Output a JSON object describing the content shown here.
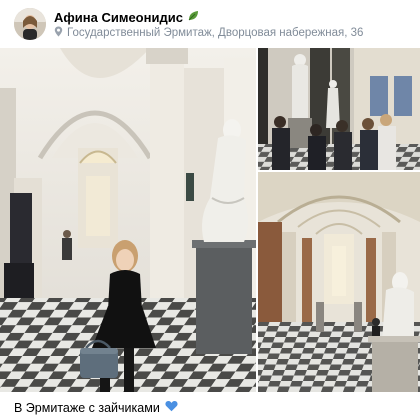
{
  "post": {
    "author": "Афина Симеонидис",
    "author_badge_icon": "leaf-emoji-icon",
    "location": "Государственный Эрмитаж, Дворцовая набережная, 36",
    "location_icon": "map-pin-icon",
    "caption": "В Эрмитаже с зайчиками",
    "caption_emoji_icon": "blue-heart-icon"
  },
  "colors": {
    "location_text": "#818c99",
    "heart": "#4a90e2",
    "leaf": "#5a9a3a"
  }
}
